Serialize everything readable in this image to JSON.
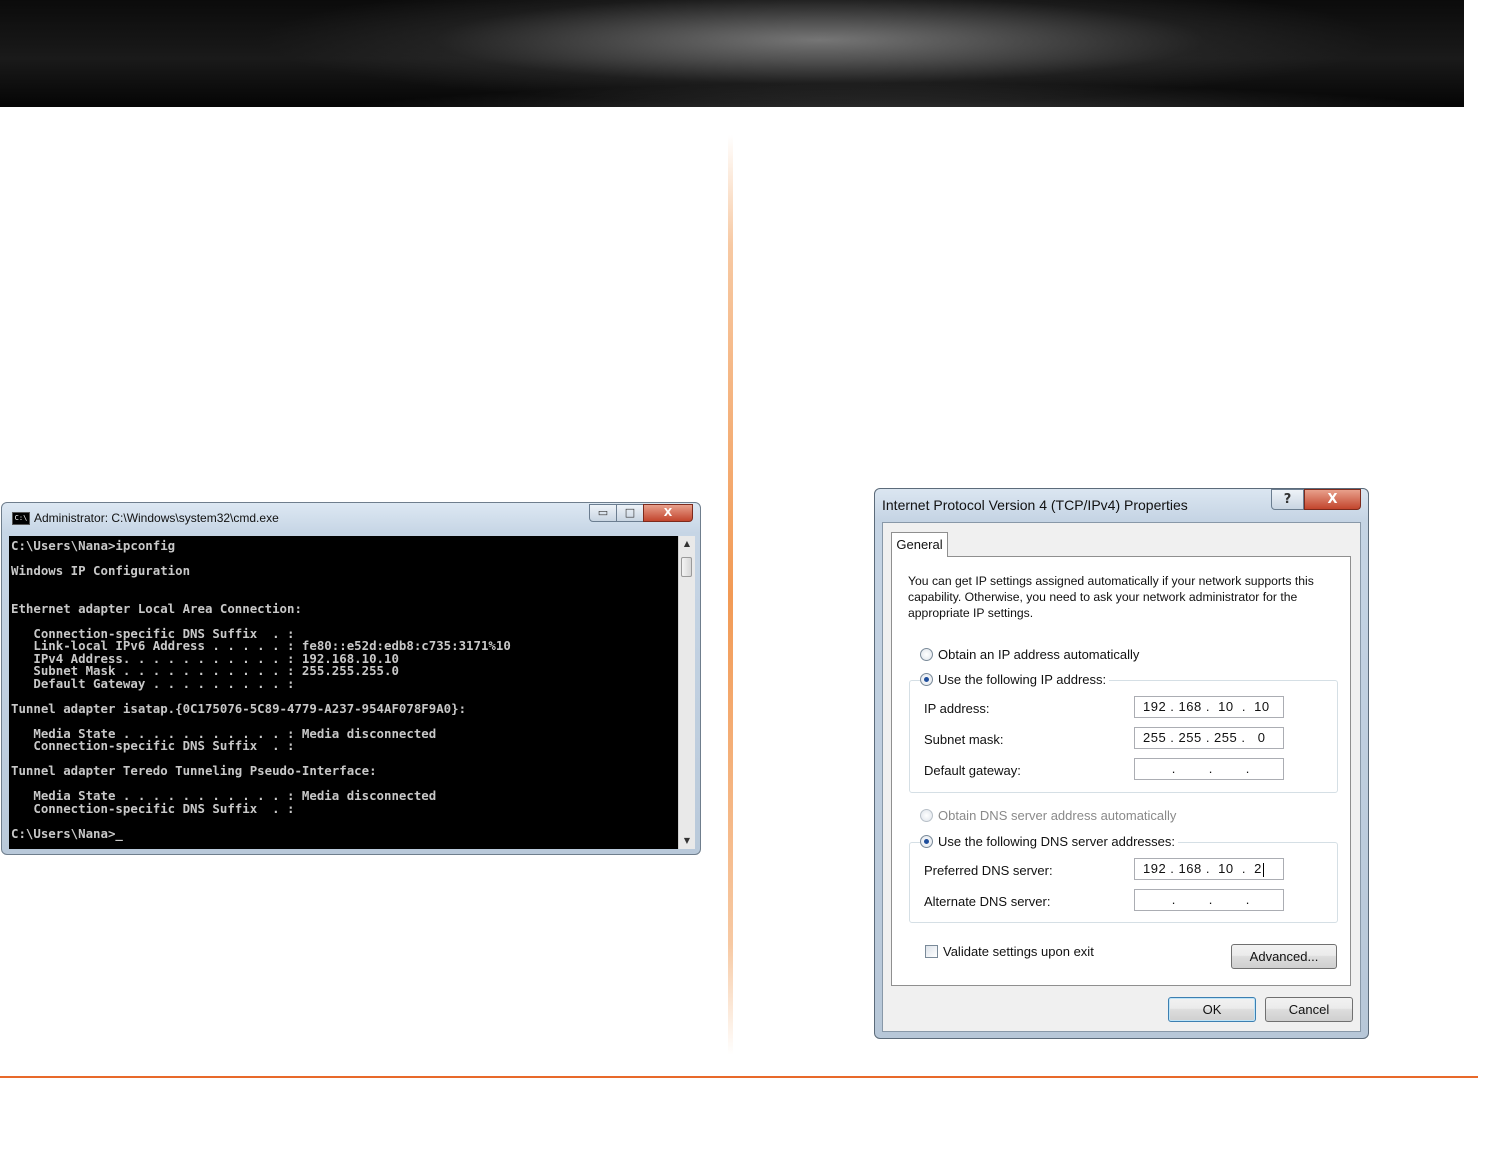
{
  "cmd_window": {
    "title": "Administrator: C:\\Windows\\system32\\cmd.exe",
    "icon_text": "C:\\",
    "minimize_glyph": "▭",
    "maximize_glyph": "□",
    "close_glyph": "X",
    "console_lines": [
      "C:\\Users\\Nana>ipconfig",
      "",
      "Windows IP Configuration",
      "",
      "",
      "Ethernet adapter Local Area Connection:",
      "",
      "   Connection-specific DNS Suffix  . :",
      "   Link-local IPv6 Address . . . . . : fe80::e52d:edb8:c735:3171%10",
      "   IPv4 Address. . . . . . . . . . . : 192.168.10.10",
      "   Subnet Mask . . . . . . . . . . . : 255.255.255.0",
      "   Default Gateway . . . . . . . . . :",
      "",
      "Tunnel adapter isatap.{0C175076-5C89-4779-A237-954AF078F9A0}:",
      "",
      "   Media State . . . . . . . . . . . : Media disconnected",
      "   Connection-specific DNS Suffix  . :",
      "",
      "Tunnel adapter Teredo Tunneling Pseudo-Interface:",
      "",
      "   Media State . . . . . . . . . . . : Media disconnected",
      "   Connection-specific DNS Suffix  . :",
      "",
      "C:\\Users\\Nana>_"
    ],
    "scroll_up_glyph": "▲",
    "scroll_down_glyph": "▼"
  },
  "ipv4_dialog": {
    "title": "Internet Protocol Version 4 (TCP/IPv4) Properties",
    "help_glyph": "?",
    "close_glyph": "X",
    "tab_label": "General",
    "intro_text": "You can get IP settings assigned automatically if your network supports this capability. Otherwise, you need to ask your network administrator for the appropriate IP settings.",
    "obtain_ip_auto_label": "Obtain an IP address automatically",
    "use_following_ip_label": "Use the following IP address:",
    "ip_address_label": "IP address:",
    "ip_address_value": "192 . 168 .  10  .  10",
    "subnet_mask_label": "Subnet mask:",
    "subnet_mask_value": "255 . 255 . 255 .   0",
    "default_gateway_label": "Default gateway:",
    "default_gateway_value": "       .        .        .",
    "obtain_dns_auto_label": "Obtain DNS server address automatically",
    "use_following_dns_label": "Use the following DNS server addresses:",
    "preferred_dns_label": "Preferred DNS server:",
    "preferred_dns_value": "192 . 168 .  10  .  2",
    "alternate_dns_label": "Alternate DNS server:",
    "alternate_dns_value": "       .        .        .",
    "validate_label": "Validate settings upon exit",
    "advanced_label": "Advanced...",
    "ok_label": "OK",
    "cancel_label": "Cancel"
  }
}
